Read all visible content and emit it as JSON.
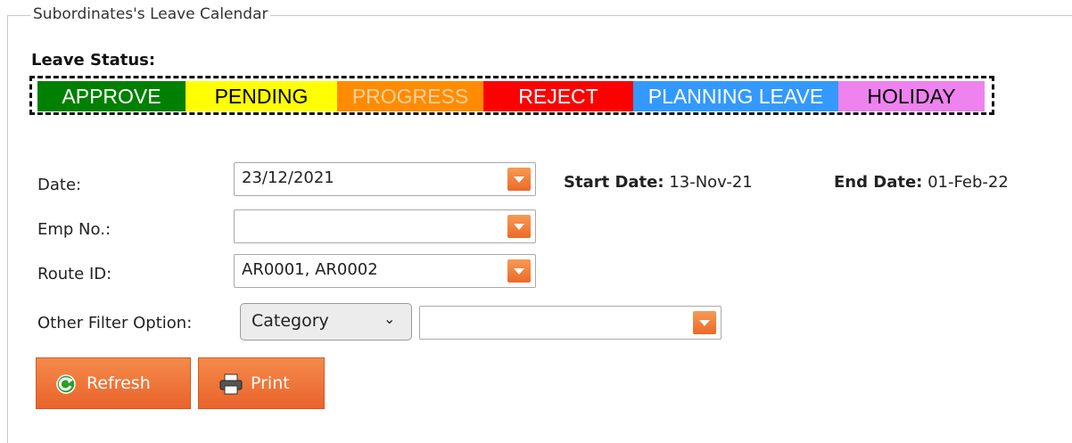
{
  "panel": {
    "title": "Subordinates's Leave Calendar"
  },
  "leave_status": {
    "label": "Leave Status:",
    "items": [
      {
        "label": "APPROVE",
        "bg": "#008000",
        "fg": "#ffffff"
      },
      {
        "label": "PENDING",
        "bg": "#ffff00",
        "fg": "#000000"
      },
      {
        "label": "PROGRESS",
        "bg": "#ff8c00",
        "fg": "#ffd0a0"
      },
      {
        "label": "REJECT",
        "bg": "#ff0000",
        "fg": "#ffffff"
      },
      {
        "label": "PLANNING LEAVE",
        "bg": "#3399ff",
        "fg": "#ffffff"
      },
      {
        "label": "HOLIDAY",
        "bg": "#ee82ee",
        "fg": "#000000"
      }
    ]
  },
  "form": {
    "date_label": "Date:",
    "date_value": "23/12/2021",
    "start_date_label": "Start Date:",
    "start_date_value": "13-Nov-21",
    "end_date_label": "End Date:",
    "end_date_value": "01-Feb-22",
    "emp_label": "Emp No.:",
    "emp_value": "",
    "route_label": "Route ID:",
    "route_value": "AR0001, AR0002",
    "other_filter_label": "Other Filter Option:",
    "other_filter_select": "Category",
    "other_filter_value": ""
  },
  "buttons": {
    "refresh": "Refresh",
    "print": "Print"
  },
  "colors": {
    "accent": "#ec6a2a"
  }
}
